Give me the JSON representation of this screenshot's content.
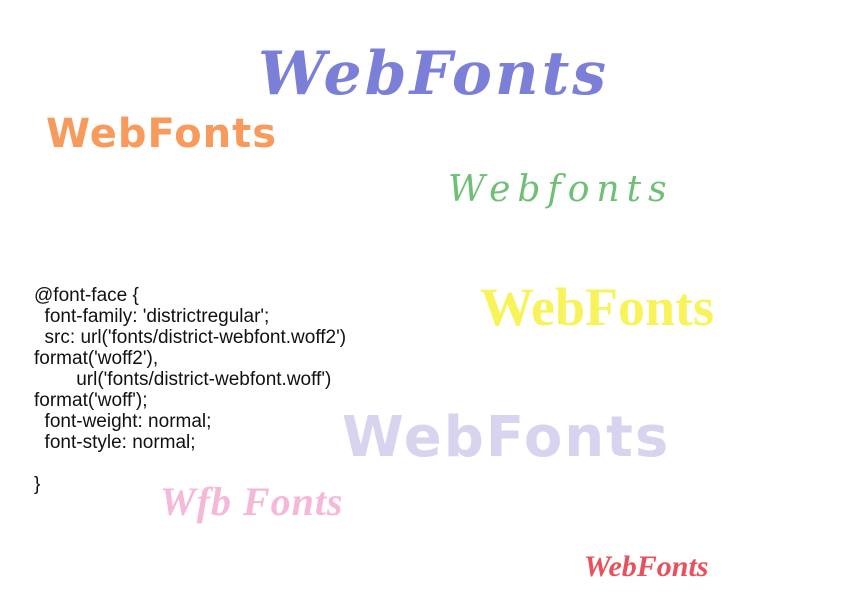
{
  "samples": [
    {
      "id": "purple",
      "text": "WebFonts",
      "color": "#7b7fd8"
    },
    {
      "id": "orange",
      "text": "WebFonts",
      "color": "#f79a5b"
    },
    {
      "id": "green",
      "text": "Webfonts",
      "color": "#6fbf76"
    },
    {
      "id": "yellow",
      "text": "WebFonts",
      "color": "#f8f35a"
    },
    {
      "id": "lavender",
      "text": "WebFonts",
      "color": "#d8d3ee"
    },
    {
      "id": "pink",
      "text": "Wfb Fonts",
      "color": "#f5b8d8"
    },
    {
      "id": "red",
      "text": "WebFonts",
      "color": "#e9505c"
    }
  ],
  "code": {
    "lines": [
      "@font-face {",
      "  font-family: 'districtregular';",
      "  src: url('fonts/district-webfont.woff2')",
      "format('woff2'),",
      "        url('fonts/district-webfont.woff')",
      "format('woff');",
      "  font-weight: normal;",
      "  font-style: normal;",
      "",
      "}"
    ]
  }
}
